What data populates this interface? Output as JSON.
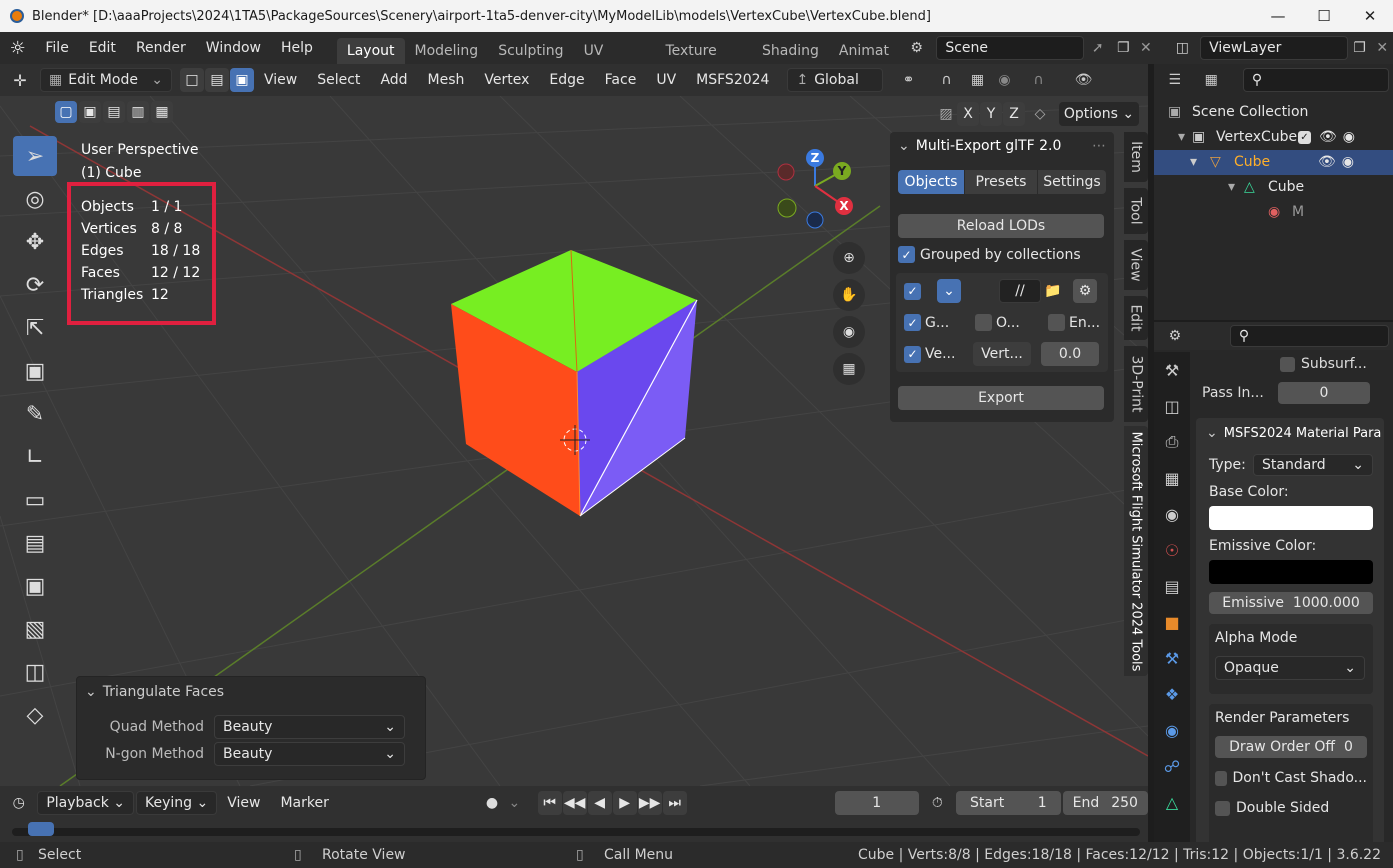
{
  "window": {
    "title": "Blender* [D:\\aaaProjects\\2024\\1TA5\\PackageSources\\Scenery\\airport-1ta5-denver-city\\MyModelLib\\models\\VertexCube\\VertexCube.blend]",
    "minimize": "—",
    "maximize": "☐",
    "close": "✕"
  },
  "menubar": {
    "items": [
      "File",
      "Edit",
      "Render",
      "Window",
      "Help"
    ],
    "workspaces": [
      "Layout",
      "Modeling",
      "Sculpting",
      "UV Editing",
      "Texture Paint",
      "Shading",
      "Animat"
    ],
    "active_workspace": "Layout",
    "scene": "Scene",
    "view_layer": "ViewLayer"
  },
  "viewport_header": {
    "mode": "Edit Mode",
    "menus": [
      "View",
      "Select",
      "Add",
      "Mesh",
      "Vertex",
      "Edge",
      "Face",
      "UV",
      "MSFS2024"
    ],
    "orientation": "Global",
    "axes": [
      "X",
      "Y",
      "Z"
    ],
    "options": "Options"
  },
  "viewport": {
    "perspective": "User Perspective",
    "object": "(1) Cube",
    "stats": [
      {
        "label": "Objects",
        "value": "1 / 1"
      },
      {
        "label": "Vertices",
        "value": "8 / 8"
      },
      {
        "label": "Edges",
        "value": "18 / 18"
      },
      {
        "label": "Faces",
        "value": "12 / 12"
      },
      {
        "label": "Triangles",
        "value": "12"
      }
    ],
    "gizmo": {
      "x": "X",
      "y": "Y",
      "z": "Z"
    },
    "colors": {
      "top": "#77ee22",
      "front": "#ff4c1a",
      "side": "#7b5cf5",
      "highlight": "#e0203f",
      "accent": "#4772b3"
    }
  },
  "npanel": {
    "title": "Multi-Export glTF 2.0",
    "tabs": [
      "Objects",
      "Presets",
      "Settings"
    ],
    "active_tab": "Objects",
    "reload": "Reload LODs",
    "grouped": "Grouped by collections",
    "path": "//",
    "row2": [
      "G...",
      "O...",
      "En..."
    ],
    "row3_label": "Ve...",
    "row3_field": "Vert...",
    "row3_value": "0.0",
    "export": "Export",
    "side_tabs": [
      "Item",
      "Tool",
      "View",
      "Edit",
      "3D-Print",
      "Microsoft Flight Simulator 2024 Tools"
    ]
  },
  "operator": {
    "title": "Triangulate Faces",
    "quad_label": "Quad Method",
    "quad_value": "Beauty",
    "ngon_label": "N-gon Method",
    "ngon_value": "Beauty"
  },
  "timeline": {
    "menus": [
      "Playback",
      "Keying",
      "View",
      "Marker"
    ],
    "current_frame": "1",
    "start_label": "Start",
    "start": "1",
    "end_label": "End",
    "end": "250"
  },
  "statusbar": {
    "left": "Select",
    "middle": "Rotate View",
    "right_action": "Call Menu",
    "info": "Cube | Verts:8/8 | Edges:18/18 | Faces:12/12 | Tris:12 | Objects:1/1 | 3.6.22"
  },
  "outliner": {
    "root": "Scene Collection",
    "collection": "VertexCube",
    "object": "Cube",
    "mesh": "Cube",
    "material": "M"
  },
  "properties": {
    "subsurf": "Subsurf...",
    "pass_index_label": "Pass In...",
    "pass_index": "0",
    "panel_title": "MSFS2024 Material Para",
    "type_label": "Type:",
    "type_value": "Standard",
    "base_color_label": "Base Color:",
    "emissive_color_label": "Emissive Color:",
    "emissive_label": "Emissive",
    "emissive_value": "1000.000",
    "alpha_mode_label": "Alpha Mode",
    "alpha_mode_value": "Opaque",
    "render_params": "Render Parameters",
    "draw_order_label": "Draw Order Off",
    "draw_order_value": "0",
    "dont_cast": "Don't Cast Shado...",
    "double_sided": "Double Sided"
  }
}
